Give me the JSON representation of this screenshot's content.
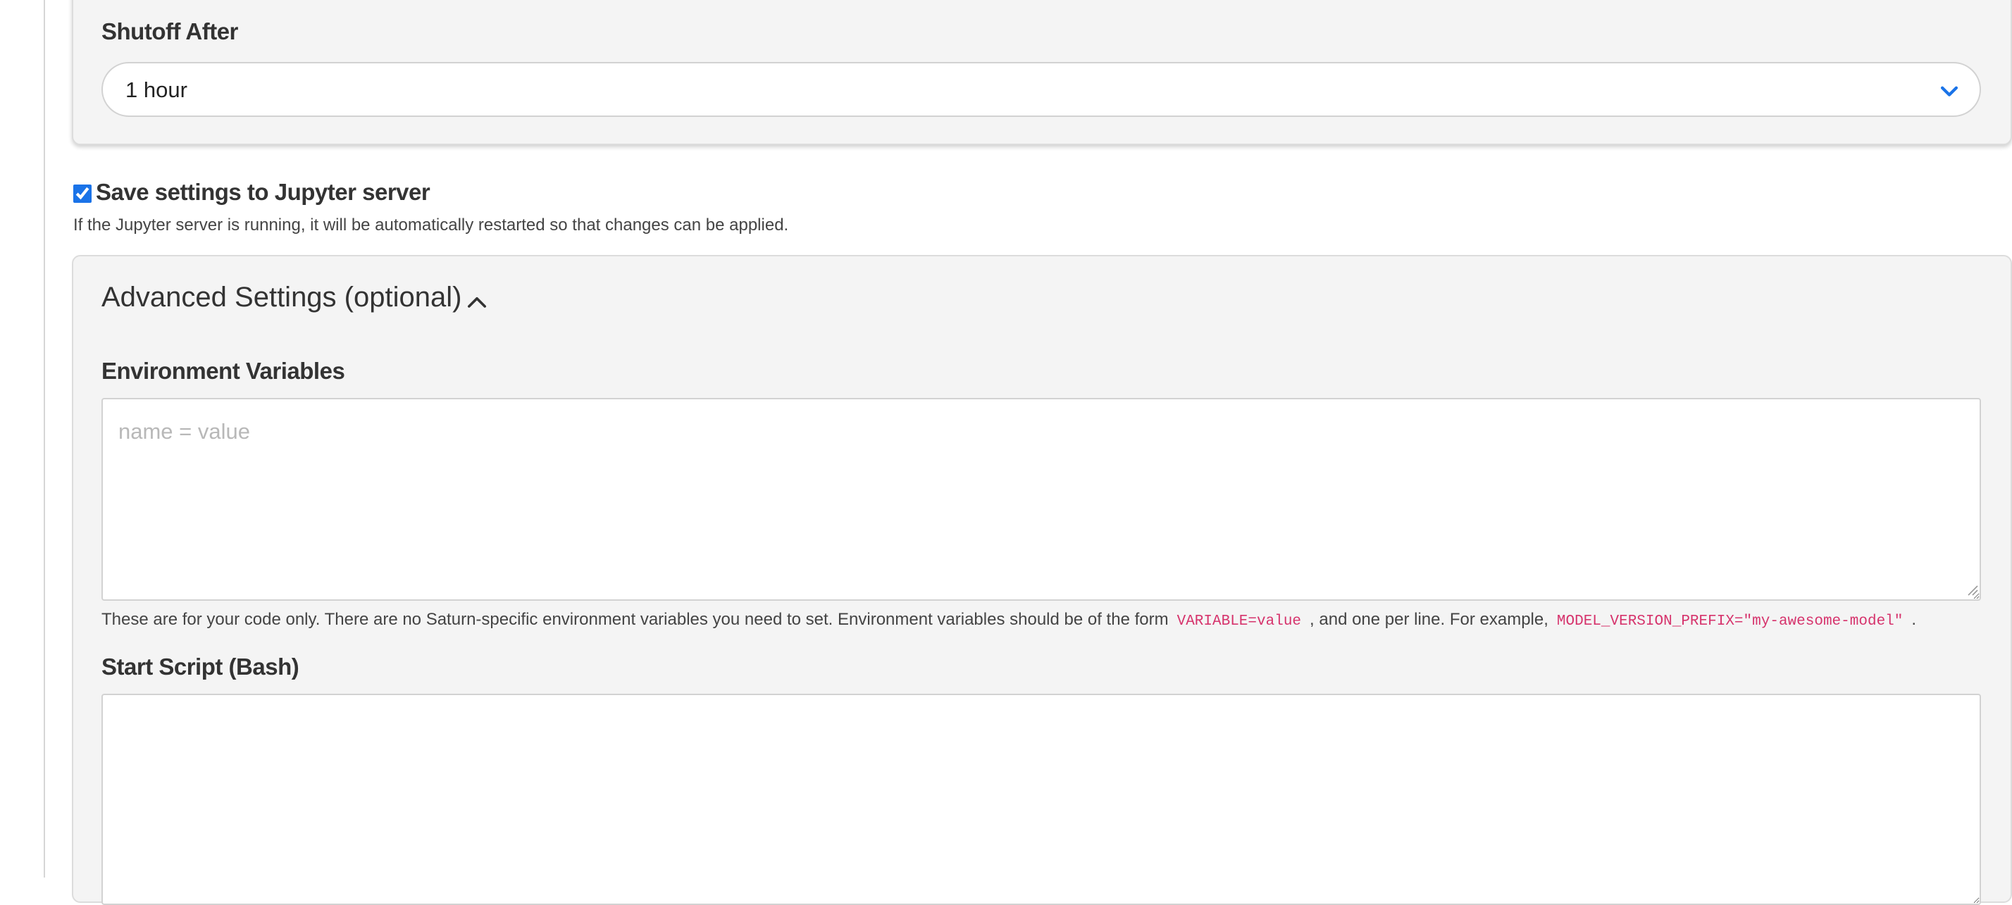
{
  "shutoff": {
    "label": "Shutoff After",
    "selected_value": "1 hour",
    "chevron_color": "#1a73e8"
  },
  "save_settings": {
    "checked": true,
    "label": "Save settings to Jupyter server",
    "help": "If the Jupyter server is running, it will be automatically restarted so that changes can be applied."
  },
  "advanced": {
    "title": "Advanced Settings (optional)",
    "expanded": true,
    "env_vars": {
      "label": "Environment Variables",
      "placeholder": "name = value",
      "value": "",
      "help_part1": "These are for your code only. There are no Saturn-specific environment variables you need to set. Environment variables should be of the form",
      "help_code1": "VARIABLE=value",
      "help_part2": ", and one per line. For example,",
      "help_code2": "MODEL_VERSION_PREFIX=\"my-awesome-model\"",
      "help_part3": "."
    },
    "start_script": {
      "label": "Start Script (Bash)",
      "value": ""
    }
  },
  "colors": {
    "card_background": "#f4f4f4",
    "code_text": "#d6336c",
    "accent": "#1a73e8"
  }
}
